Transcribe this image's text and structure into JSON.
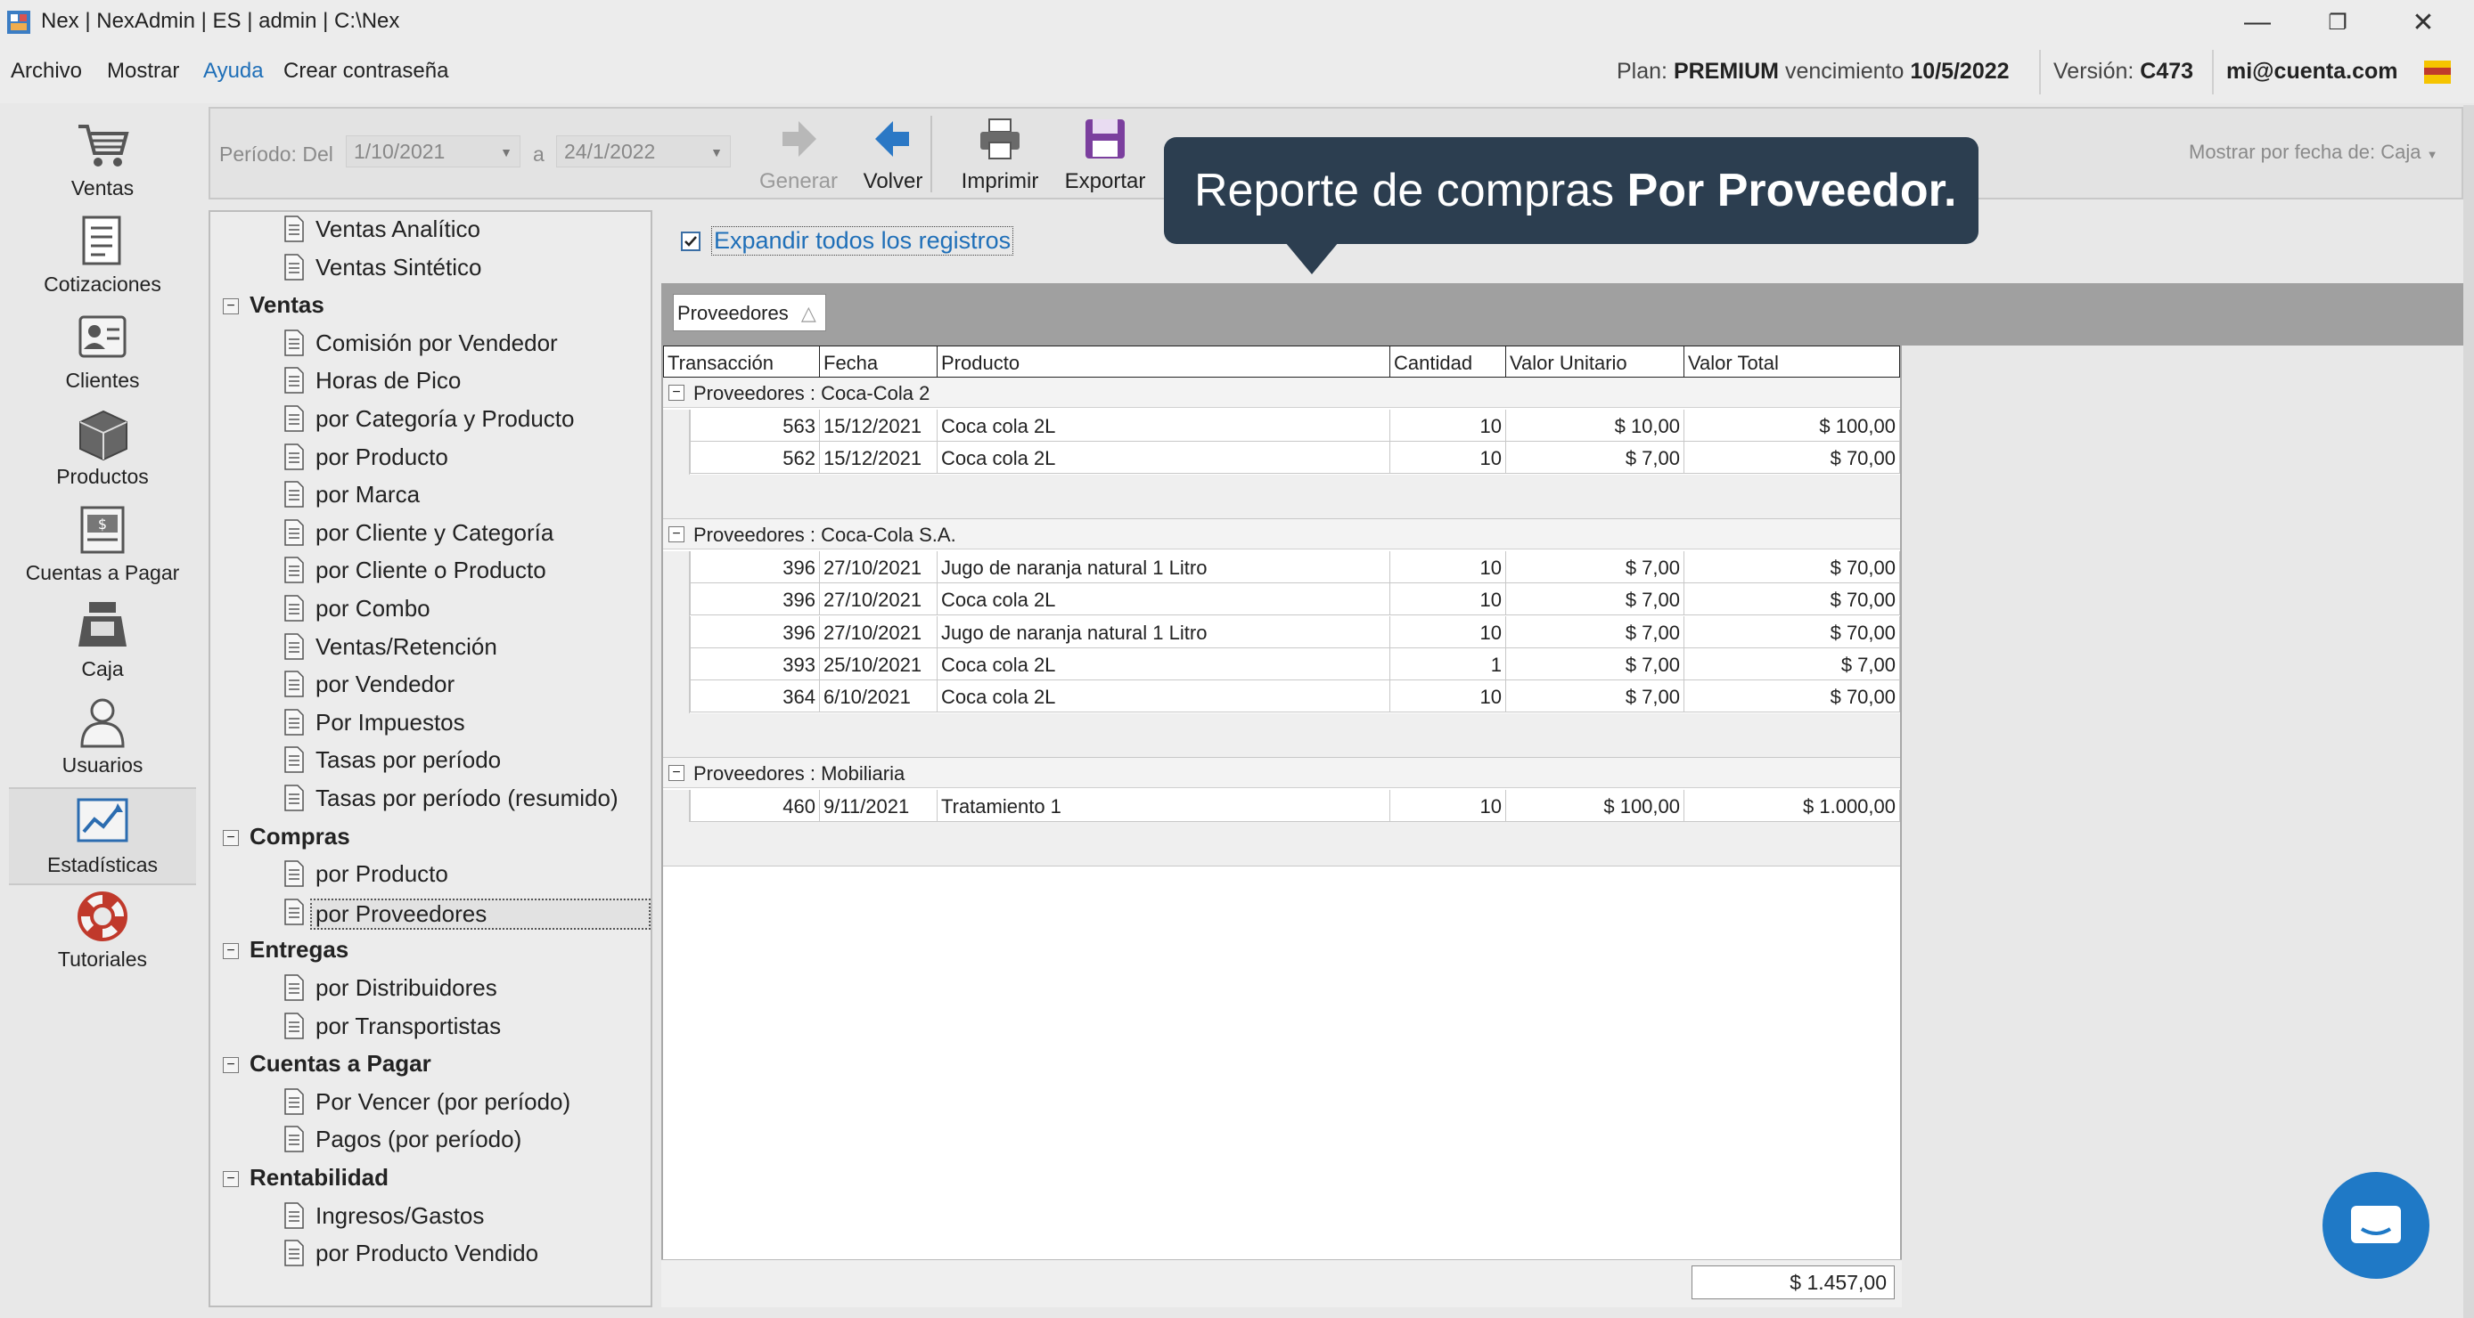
{
  "window": {
    "title": "Nex | NexAdmin | ES | admin | C:\\Nex",
    "minimize": "—",
    "restore": "❐",
    "close": "✕"
  },
  "menu": {
    "items": [
      "Archivo",
      "Mostrar",
      "Ayuda",
      "Crear contraseña"
    ],
    "plan_label": "Plan:",
    "plan_value": "PREMIUM",
    "vencimiento_label": "vencimiento",
    "vencimiento_value": "10/5/2022",
    "version_label": "Versión:",
    "version_value": "C473",
    "account": "mi@cuenta.com"
  },
  "nav": {
    "items": [
      "Ventas",
      "Cotizaciones",
      "Clientes",
      "Productos",
      "Cuentas a Pagar",
      "Caja",
      "Usuarios",
      "Estadísticas",
      "Tutoriales"
    ],
    "selected": "Estadísticas"
  },
  "toolbar": {
    "periodo_label": "Período: Del",
    "from_date": "1/10/2021",
    "to_label": "a",
    "to_date": "24/1/2022",
    "generar": "Generar",
    "volver": "Volver",
    "imprimir": "Imprimir",
    "exportar": "Exportar",
    "mostrar_por": "Mostrar por fecha de: Caja"
  },
  "tree": {
    "top_items": [
      "Ventas Analítico",
      "Ventas Sintético"
    ],
    "groups": [
      {
        "name": "Ventas",
        "items": [
          "Comisión por Vendedor",
          "Horas de Pico",
          "por Categoría y Producto",
          "por Producto",
          "por Marca",
          "por Cliente y Categoría",
          "por Cliente o Producto",
          "por Combo",
          "Ventas/Retención",
          "por Vendedor",
          "Por Impuestos",
          "Tasas por período",
          "Tasas por período (resumido)"
        ]
      },
      {
        "name": "Compras",
        "items": [
          "por Producto",
          "por Proveedores"
        ]
      },
      {
        "name": "Entregas",
        "items": [
          "por Distribuidores",
          "por Transportistas"
        ]
      },
      {
        "name": "Cuentas a Pagar",
        "items": [
          "Por Vencer (por período)",
          "Pagos (por período)"
        ]
      },
      {
        "name": "Rentabilidad",
        "items": [
          "Ingresos/Gastos",
          "por Producto Vendido"
        ]
      }
    ],
    "selected": "por Proveedores"
  },
  "report": {
    "expand_label": "Expandir todos los registros",
    "expand_checked": true,
    "group_chip": "Proveedores",
    "group_chip_sort": "△",
    "columns": [
      "Transacción",
      "Fecha",
      "Producto",
      "Cantidad",
      "Valor Unitario",
      "Valor Total"
    ],
    "groups": [
      {
        "title": "Proveedores : Coca-Cola 2",
        "rows": [
          [
            "563",
            "15/12/2021",
            "Coca cola 2L",
            "10",
            "$ 10,00",
            "$ 100,00"
          ],
          [
            "562",
            "15/12/2021",
            "Coca cola 2L",
            "10",
            "$ 7,00",
            "$ 70,00"
          ]
        ]
      },
      {
        "title": "Proveedores : Coca-Cola S.A.",
        "rows": [
          [
            "396",
            "27/10/2021",
            "Jugo de naranja natural 1 Litro",
            "10",
            "$ 7,00",
            "$ 70,00"
          ],
          [
            "396",
            "27/10/2021",
            "Coca cola 2L",
            "10",
            "$ 7,00",
            "$ 70,00"
          ],
          [
            "396",
            "27/10/2021",
            "Jugo de naranja natural 1 Litro",
            "10",
            "$ 7,00",
            "$ 70,00"
          ],
          [
            "393",
            "25/10/2021",
            "Coca cola 2L",
            "1",
            "$ 7,00",
            "$ 7,00"
          ],
          [
            "364",
            "6/10/2021",
            "Coca cola 2L",
            "10",
            "$ 7,00",
            "$ 70,00"
          ]
        ]
      },
      {
        "title": "Proveedores : Mobiliaria",
        "rows": [
          [
            "460",
            "9/11/2021",
            "Tratamiento 1",
            "10",
            "$ 100,00",
            "$ 1.000,00"
          ]
        ]
      }
    ],
    "grand_total": "$ 1.457,00"
  },
  "tooltip": {
    "text": "Reporte de compras ",
    "bold": "Por Proveedor."
  },
  "colors": {
    "accent": "#1f6fb8",
    "tooltip_bg": "#2c3e50",
    "chat_button": "#1f79c6"
  }
}
